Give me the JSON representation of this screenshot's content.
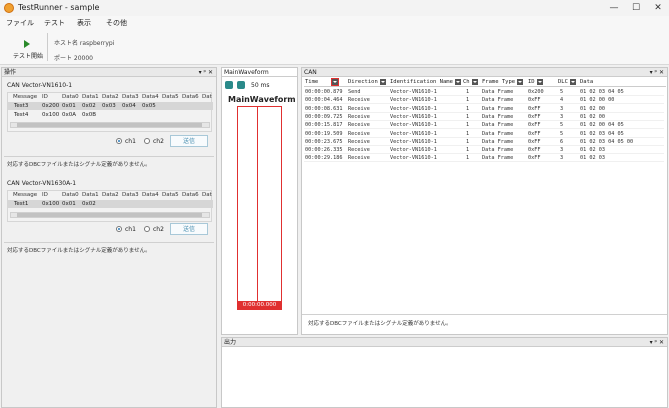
{
  "window": {
    "title": "TestRunner - sample",
    "minimize": "—",
    "maximize": "☐",
    "close": "✕"
  },
  "menu": [
    "ファイル",
    "テスト",
    "表示",
    "その他"
  ],
  "toolbar": {
    "run_label": "テスト開始",
    "host_label": "ホスト名 raspberrypi",
    "port_label": "ポート 20000"
  },
  "ops_panel": {
    "title": "操作",
    "controls": "▾ ᵖ ✕",
    "groups": [
      {
        "title": "CAN Vector-VN1610-1",
        "headers": [
          "Message",
          "ID",
          "Data0",
          "Data1",
          "Data2",
          "Data3",
          "Data4",
          "Data5",
          "Data6",
          "Dat"
        ],
        "rows": [
          [
            "Test3",
            "0x200",
            "0x01",
            "0x02",
            "0x03",
            "0x04",
            "0x05"
          ],
          [
            "Test4",
            "0x100",
            "0x0A",
            "0x0B"
          ]
        ],
        "ch1": "ch1",
        "ch2": "ch2",
        "send": "送信",
        "note": "対応するDBCファイルまたはシグナル定義がありません。"
      },
      {
        "title": "CAN Vector-VN1630A-1",
        "headers": [
          "Message",
          "ID",
          "Data0",
          "Data1",
          "Data2",
          "Data3",
          "Data4",
          "Data5",
          "Data6",
          "Dat"
        ],
        "rows": [
          [
            "Test1",
            "0x100",
            "0x01",
            "0x02"
          ]
        ],
        "ch1": "ch1",
        "ch2": "ch2",
        "send": "送信",
        "note": "対応するDBCファイルまたはシグナル定義がありません。"
      }
    ]
  },
  "waveform": {
    "tab": "MainWaveform",
    "zoom_in": "+",
    "zoom_out": "−",
    "interval": "50 ms",
    "heading": "MainWaveform",
    "time": "0:00:00.000"
  },
  "can_panel": {
    "title": "CAN",
    "headers": [
      "Time",
      "Direction",
      "Identification Name",
      "Ch",
      "Frame Type",
      "ID",
      "DLC",
      "Data"
    ],
    "rows": [
      [
        "00:00:00.879",
        "Send",
        "Vector-VN1610-1",
        "1",
        "Data Frame",
        "0x200",
        "5",
        "01 02 03 04 05"
      ],
      [
        "00:00:04.464",
        "Receive",
        "Vector-VN1610-1",
        "1",
        "Data Frame",
        "0xFF",
        "4",
        "01 02 00 00"
      ],
      [
        "00:00:08.631",
        "Receive",
        "Vector-VN1610-1",
        "1",
        "Data Frame",
        "0xFF",
        "3",
        "01 02 00"
      ],
      [
        "00:00:09.725",
        "Receive",
        "Vector-VN1610-1",
        "1",
        "Data Frame",
        "0xFF",
        "3",
        "01 02 00"
      ],
      [
        "00:00:15.817",
        "Receive",
        "Vector-VN1610-1",
        "1",
        "Data Frame",
        "0xFF",
        "5",
        "01 02 00 04 05"
      ],
      [
        "00:00:19.509",
        "Receive",
        "Vector-VN1610-1",
        "1",
        "Data Frame",
        "0xFF",
        "5",
        "01 02 03 04 05"
      ],
      [
        "00:00:23.675",
        "Receive",
        "Vector-VN1610-1",
        "1",
        "Data Frame",
        "0xFF",
        "6",
        "01 02 03 04 05 00"
      ],
      [
        "00:00:26.335",
        "Receive",
        "Vector-VN1610-1",
        "1",
        "Data Frame",
        "0xFF",
        "3",
        "01 02 03"
      ],
      [
        "00:00:29.186",
        "Receive",
        "Vector-VN1610-1",
        "1",
        "Data Frame",
        "0xFF",
        "3",
        "01 02 03"
      ]
    ],
    "note": "対応するDBCファイルまたはシグナル定義がありません。"
  },
  "output_panel": {
    "title": "出力"
  },
  "icons": {
    "app": "app-icon",
    "run": "play-icon",
    "zoom_in": "zoom-in-icon",
    "zoom_out": "zoom-out-icon",
    "filter": "filter-dropdown-icon"
  },
  "colors": {
    "accent": "#2a8a8a",
    "cursor": "#e03030",
    "selected_row": "#d6d6d6"
  }
}
